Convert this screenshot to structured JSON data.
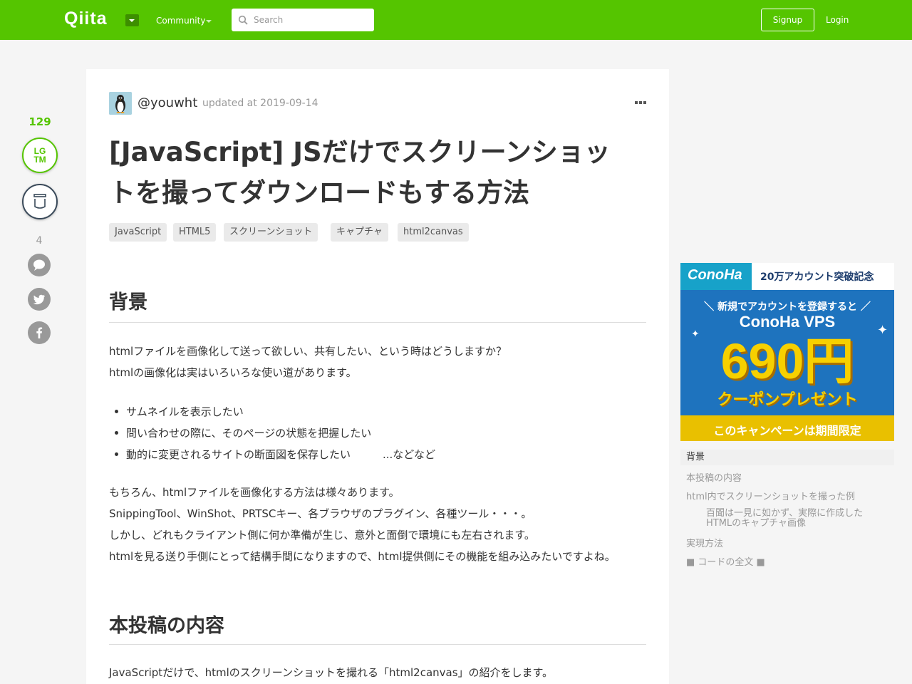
{
  "header": {
    "logo": "Qiita",
    "community_label": "Community",
    "search_placeholder": "Search",
    "signup_label": "Signup",
    "login_label": "Login",
    "brand_color": "#55c500"
  },
  "rail": {
    "likes_count": "129",
    "lgtm_top": "LG",
    "lgtm_bottom": "TM",
    "comment_count": "4",
    "icons": [
      "stock-icon",
      "comment-icon",
      "twitter-icon",
      "facebook-icon"
    ]
  },
  "article": {
    "author": "@youwht",
    "updated": "updated at 2019-09-14",
    "title_line1": "[JavaScript] JSだけでスクリーンショッ",
    "title_line2": "トを撮ってダウンロードもする方法",
    "tags": [
      "JavaScript",
      "HTML5",
      "スクリーンショット",
      "キャプチャ",
      "html2canvas"
    ],
    "section1": {
      "heading": "背景",
      "paragraphs": [
        "htmlファイルを画像化して送って欲しい、共有したい、という時はどうしますか？",
        "htmlの画像化は実はいろいろな使い道があります。"
      ],
      "list": [
        "サムネイルを表示したい",
        "問い合わせの際に、そのページの状態を把握したい",
        "動的に変更されるサイトの断面図を保存したい　　　...などなど"
      ],
      "paragraphs2": [
        "もちろん、htmlファイルを画像化する方法は様々あります。",
        "SnippingTool、WinShot、PRTSCキー、各ブラウザのプラグイン、各種ツール・・・。",
        "しかし、どれもクライアント側に何か準備が生じ、意外と面倒で環境にも左右されます。",
        "htmlを見る送り手側にとって結構手間になりますので、html提供側にその機能を組み込みたいですよね。"
      ]
    },
    "section2": {
      "heading": "本投稿の内容",
      "paragraph": "JavaScriptだけで、htmlのスクリーンショットを撮れる「html2canvas」の紹介をします。"
    }
  },
  "ad": {
    "logo": "ConoHa",
    "badge": "20万アカウント突破記念",
    "line1": "＼ 新規でアカウントを登録すると ／",
    "line2": "ConoHa VPS",
    "price": "690円",
    "line3": "クーポンプレゼント",
    "footer": "このキャンペーンは期間限定"
  },
  "toc": {
    "items": [
      "背景",
      "本投稿の内容",
      "html内でスクリーンショットを撮った例"
    ],
    "sub_line1": "百聞は一見に如かず、実際に作成した",
    "sub_line2": "HTMLのキャプチャ画像",
    "items2": [
      "実現方法",
      "■ コードの全文 ■"
    ]
  }
}
